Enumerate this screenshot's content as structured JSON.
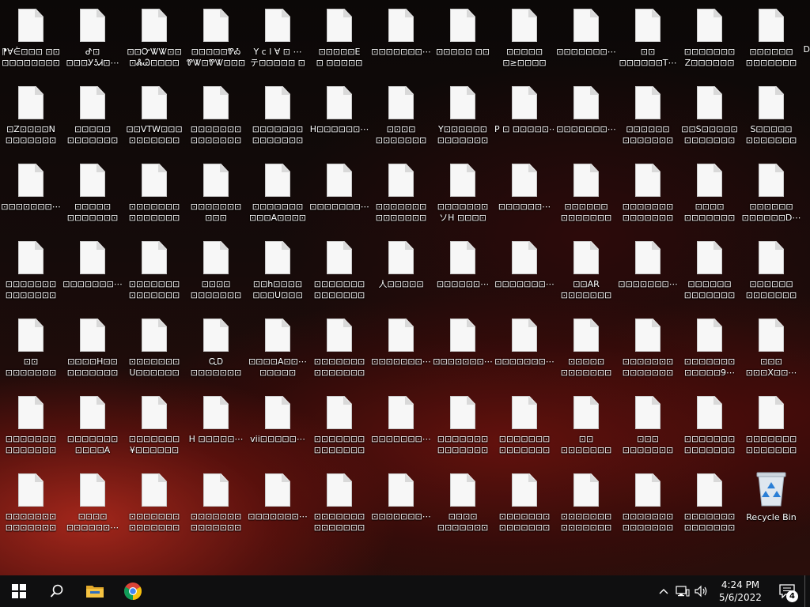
{
  "desktop": {
    "file_rows": [
      [
        "⁋∀⋵⊡⊡⊡ ⊡⊡\n⊡⊡⊡⊡⊡⊡⊡⊡",
        "ᕷ⊡\n⊡⊡⊡ᎩᎼᏗ⊡⋯",
        "⊡⊡ᏅᏔᏔ⊡⊡\n⊡ᏜᏊ⊡⊡⊡⊡",
        "⊡⊡⊡⊡⊡ᏈᎣ\nᏈᏔ⊡ᏈᏔ⊡⊡⊡",
        "Y c l ∀ ⊡ ⋯\nテ⊡⊡⊡⊡⊡ ⊡",
        "⊡⊡⊡⊡⊡E\n⊡ ⊡⊡⊡⊡⊡",
        "⊡⊡⊡⊡⊡⊡⊡⋯",
        "⊡⊡⊡⊡⊡ ⊡⊡",
        "⊡⊡⊡⊡⊡\n⊡≥⊡⊡⊡⊡",
        "⊡⊡⊡⊡⊡⊡⊡⋯",
        "⊡⊡\n⊡⊡⊡⊡⊡⊡T⋯",
        "⊡⊡⊡⊡⊡⊡⊡\nZ⊡⊡⊡⊡⊡⊡",
        "⊡⊡⊡⊡⊡⊡\n⊡⊡⊡⊡⊡⊡⊡"
      ],
      [
        "⊡Z⊡⊡⊡⊡N\n⊡⊡⊡⊡⊡⊡⊡",
        "⊡⊡⊡⊡⊡\n⊡⊡⊡⊡⊡⊡⊡",
        "⊡⊡VTW⊡⊡⊡\n⊡⊡⊡⊡⊡⊡⊡",
        "⊡⊡⊡⊡⊡⊡⊡\n⊡⊡⊡⊡⊡⊡⊡",
        "⊡⊡⊡⊡⊡⊡⊡\n⊡⊡⊡⊡⊡⊡⊡",
        "H⊡⊡⊡⊡⊡⊡⋯",
        "⊡⊡⊡⊡\n⊡⊡⊡⊡⊡⊡⊡",
        "Y⊡⊡⊡⊡⊡⊡\n⊡⊡⊡⊡⊡⊡⊡",
        "P ⊡ ⊡⊡⊡⊡⊡⋯",
        "⊡⊡⊡⊡⊡⊡⊡⋯",
        "⊡⊡⊡⊡⊡⊡\n⊡⊡⊡⊡⊡⊡⊡",
        "⊡⊡S⊡⊡⊡⊡⊡\n⊡⊡⊡⊡⊡⊡⊡",
        "S⊡⊡⊡⊡⊡\n⊡⊡⊡⊡⊡⊡⊡"
      ],
      [
        "⊡⊡⊡⊡⊡⊡⊡⋯",
        "⊡⊡⊡⊡⊡\n⊡⊡⊡⊡⊡⊡⊡",
        "⊡⊡⊡⊡⊡⊡⊡\n⊡⊡⊡⊡⊡⊡⊡",
        "⊡⊡⊡⊡⊡⊡⊡\n⊡⊡⊡",
        "⊡⊡⊡⊡⊡⊡⊡\n⊡⊡⊡A⊡⊡⊡⊡",
        "⊡⊡⊡⊡⊡⊡⊡⋯",
        "⊡⊡⊡⊡⊡⊡⊡\n⊡⊡⊡⊡⊡⊡⊡",
        "⊡⊡⊡⊡⊡⊡⊡\nソH ⊡⊡⊡⊡",
        "⊡⊡⊡⊡⊡⊡⋯",
        "⊡⊡⊡⊡⊡⊡\n⊡⊡⊡⊡⊡⊡⊡",
        "⊡⊡⊡⊡⊡⊡⊡\n⊡⊡⊡⊡⊡⊡⊡",
        "⊡⊡⊡⊡\n⊡⊡⊡⊡⊡⊡⊡",
        "⊡⊡⊡⊡⊡⊡\n⊡⊡⊡⊡⊡⊡D⋯"
      ],
      [
        "⊡⊡⊡⊡⊡⊡⊡\n⊡⊡⊡⊡⊡⊡⊡",
        "⊡⊡⊡⊡⊡⊡⊡⋯",
        "⊡⊡⊡⊡⊡⊡⊡\n⊡⊡⊡⊡⊡⊡⊡",
        "⊡⊡⊡⊡\n⊡⊡⊡⊡⊡⊡⊡",
        "⊡⊡h⊡⊡⊡⊡\n⊡⊡⊡U⊡⊡⊡",
        "⊡⊡⊡⊡⊡⊡⊡\n⊡⊡⊡⊡⊡⊡⊡",
        "人⊡⊡⊡⊡⊡",
        "⊡⊡⊡⊡⊡⊡⋯",
        "⊡⊡⊡⊡⊡⊡⊡⋯",
        "⊡⊡AR\n⊡⊡⊡⊡⊡⊡⊡",
        "⊡⊡⊡⊡⊡⊡⊡⋯",
        "⊡⊡⊡⊡⊡⊡\n⊡⊡⊡⊡⊡⊡⊡",
        "⊡⊡⊡⊡⊡⊡\n⊡⊡⊡⊡⊡⊡⊡"
      ],
      [
        "⊡⊡\n⊡⊡⊡⊡⊡⊡⊡",
        "⊡⊡⊡⊡H⊡⊡\n⊡⊡⊡⊡⊡⊡⊡",
        "⊡⊡⊡⊡⊡⊡⊡\nU⊡⊡⊡⊡⊡⊡",
        "ᏩᎠ\n⊡⊡⊡⊡⊡⊡⊡",
        "⊡⊡⊡⊡A⊡⊡⋯\n⊡⊡⊡⊡⊡",
        "⊡⊡⊡⊡⊡⊡⊡\n⊡⊡⊡⊡⊡⊡⊡",
        "⊡⊡⊡⊡⊡⊡⊡⋯",
        "⊡⊡⊡⊡⊡⊡⊡⋯",
        "⊡⊡⊡⊡⊡⊡⊡⋯",
        "⊡⊡⊡⊡⊡\n⊡⊡⊡⊡⊡⊡⊡",
        "⊡⊡⊡⊡⊡⊡⊡\n⊡⊡⊡⊡⊡⊡⊡",
        "⊡⊡⊡⊡⊡⊡⊡\n⊡⊡⊡⊡⊡9⋯",
        "⊡⊡⊡\n⊡⊡⊡X⊡⊡⋯"
      ],
      [
        "⊡⊡⊡⊡⊡⊡⊡\n⊡⊡⊡⊡⊡⊡⊡",
        "⊡⊡⊡⊡⊡⊡⊡\n⊡⊡⊡⊡A",
        "⊡⊡⊡⊡⊡⊡⊡\n¥⊡⊡⊡⊡⊡⊡",
        "H ⊡⊡⊡⊡⊡⋯",
        "vii⊡⊡⊡⊡⊡⋯",
        "⊡⊡⊡⊡⊡⊡⊡\n⊡⊡⊡⊡⊡⊡⊡",
        "⊡⊡⊡⊡⊡⊡⊡⋯",
        "⊡⊡⊡⊡⊡⊡⊡\n⊡⊡⊡⊡⊡⊡⊡",
        "⊡⊡⊡⊡⊡⊡⊡\n⊡⊡⊡⊡⊡⊡⊡",
        "⊡⊡\n⊡⊡⊡⊡⊡⊡⊡",
        "⊡⊡⊡\n⊡⊡⊡⊡⊡⊡⊡",
        "⊡⊡⊡⊡⊡⊡⊡\n⊡⊡⊡⊡⊡⊡⊡",
        "⊡⊡⊡⊡⊡⊡⊡\n⊡⊡⊡⊡⊡⊡⊡"
      ],
      [
        "⊡⊡⊡⊡⊡⊡⊡\n⊡⊡⊡⊡⊡⊡⊡",
        "⊡⊡⊡⊡\n⊡⊡⊡⊡⊡⊡⋯",
        "⊡⊡⊡⊡⊡⊡⊡\n⊡⊡⊡⊡⊡⊡⊡",
        "⊡⊡⊡⊡⊡⊡⊡\n⊡⊡⊡⊡⊡⊡⊡",
        "⊡⊡⊡⊡⊡⊡⊡⋯",
        "⊡⊡⊡⊡⊡⊡⊡\n⊡⊡⊡⊡⊡⊡⊡",
        "⊡⊡⊡⊡⊡⊡⊡⋯",
        "⊡⊡⊡⊡\n⊡⊡⊡⊡⊡⊡⊡",
        "⊡⊡⊡⊡⊡⊡⊡\n⊡⊡⊡⊡⊡⊡⊡",
        "⊡⊡⊡⊡⊡⊡⊡\n⊡⊡⊡⊡⊡⊡⊡",
        "⊡⊡⊡⊡⊡⊡⊡\n⊡⊡⊡⊡⊡⊡⊡",
        "⊡⊡⊡⊡⊡⊡⊡\n⊡⊡⊡⊡⊡⊡⊡"
      ]
    ],
    "partial_edge_label": "D",
    "recycle_bin_label": "Recycle Bin"
  },
  "taskbar": {
    "start_icon": "windows-logo-icon",
    "search_icon": "search-icon",
    "pinned": [
      {
        "name": "file-explorer-icon"
      },
      {
        "name": "chrome-icon"
      }
    ],
    "tray": {
      "overflow_icon": "chevron-up-icon",
      "network_icon": "network-icon",
      "volume_icon": "volume-icon",
      "time": "4:24 PM",
      "date": "5/6/2022",
      "notification_count": "4"
    }
  },
  "colors": {
    "taskbar_bg": "#0f0f10",
    "explorer_yellow": "#f5c342",
    "recycle_blue": "#2b7fd6"
  }
}
